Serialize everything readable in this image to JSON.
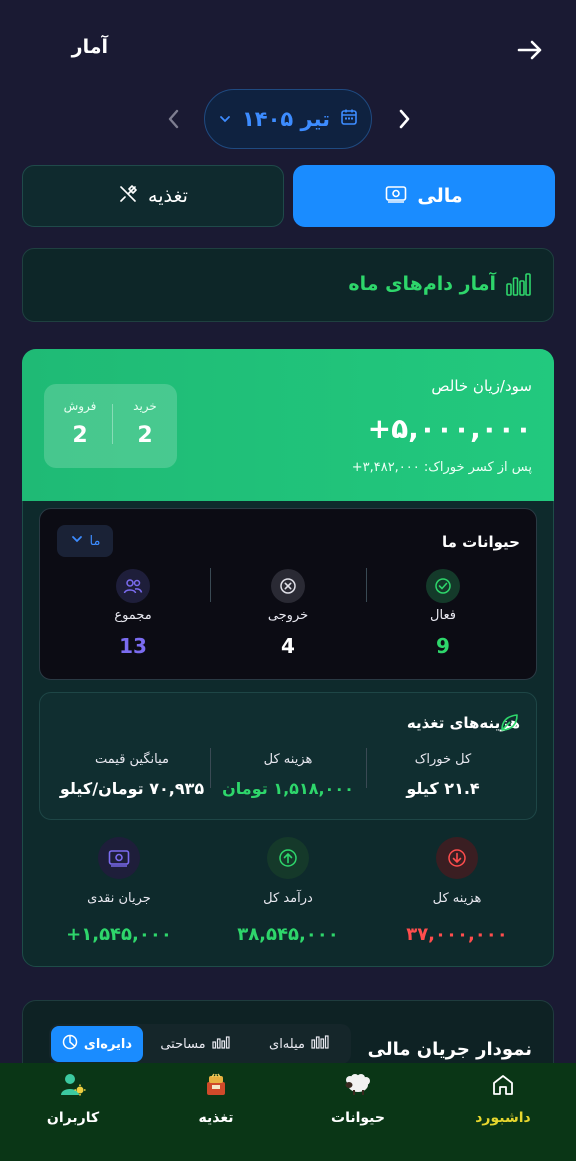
{
  "header": {
    "title": "آمار"
  },
  "month_selector": {
    "label": "تیر ۱۴۰۵"
  },
  "tabs": [
    {
      "label": "مالی",
      "active": true
    },
    {
      "label": "تغذیه",
      "active": false
    }
  ],
  "stats_card": {
    "title": "آمار دام‌های ماه"
  },
  "profit": {
    "label": "سود/زیان خالص",
    "value": "+۵,۰۰۰,۰۰۰",
    "sub": "پس از کسر خوراک: ۳,۴۸۲,۰۰۰+"
  },
  "buy_sell": {
    "buy_label": "خرید",
    "buy_value": "2",
    "sell_label": "فروش",
    "sell_value": "2"
  },
  "animals": {
    "title": "حیوانات ما",
    "select_label": "ما",
    "items": [
      {
        "label": "فعال",
        "value": "9",
        "color": "#2ed66b"
      },
      {
        "label": "خروجی",
        "value": "4",
        "color": "#ffffff"
      },
      {
        "label": "مجموع",
        "value": "13",
        "color": "#7b6cf0"
      }
    ]
  },
  "feed_costs": {
    "title": "هزینه‌های تغذیه",
    "items": [
      {
        "label": "کل خوراک",
        "value": "۲۱.۴ کیلو",
        "color": "#ffffff"
      },
      {
        "label": "هزینه کل",
        "value": "۱,۵۱۸,۰۰۰ تومان",
        "color": "#2ed66b"
      },
      {
        "label": "میانگین قیمت",
        "value": "۷۰,۹۳۵ تومان/کیلو",
        "color": "#ffffff"
      }
    ]
  },
  "cashflow": [
    {
      "label": "هزینه کل",
      "value": "۳۷,۰۰۰,۰۰۰",
      "color": "#ff4d4d",
      "icon": "arrow-down-circle-icon"
    },
    {
      "label": "درآمد کل",
      "value": "۳۸,۵۴۵,۰۰۰",
      "color": "#2ed66b",
      "icon": "arrow-up-circle-icon"
    },
    {
      "label": "جریان نقدی",
      "value": "۱,۵۴۵,۰۰۰+",
      "color": "#2ed66b",
      "icon": "banknote-icon"
    }
  ],
  "chart_card": {
    "title": "نمودار جریان مالی",
    "segments": [
      {
        "label": "دایره‌ای",
        "active": true
      },
      {
        "label": "مساحتی",
        "active": false
      },
      {
        "label": "میله‌ای",
        "active": false
      }
    ]
  },
  "bottom_nav": [
    {
      "label": "داشبورد",
      "icon": "home-icon",
      "active": true
    },
    {
      "label": "حیوانات",
      "icon": "sheep-icon",
      "active": false
    },
    {
      "label": "تغذیه",
      "icon": "feed-icon",
      "active": false
    },
    {
      "label": "کاربران",
      "icon": "users-icon",
      "active": false
    }
  ],
  "colors": {
    "accent": "#1a8cff",
    "green": "#2ed66b",
    "red": "#ff4d4d",
    "purple": "#7b6cf0",
    "nav_active": "#e6d62e"
  }
}
